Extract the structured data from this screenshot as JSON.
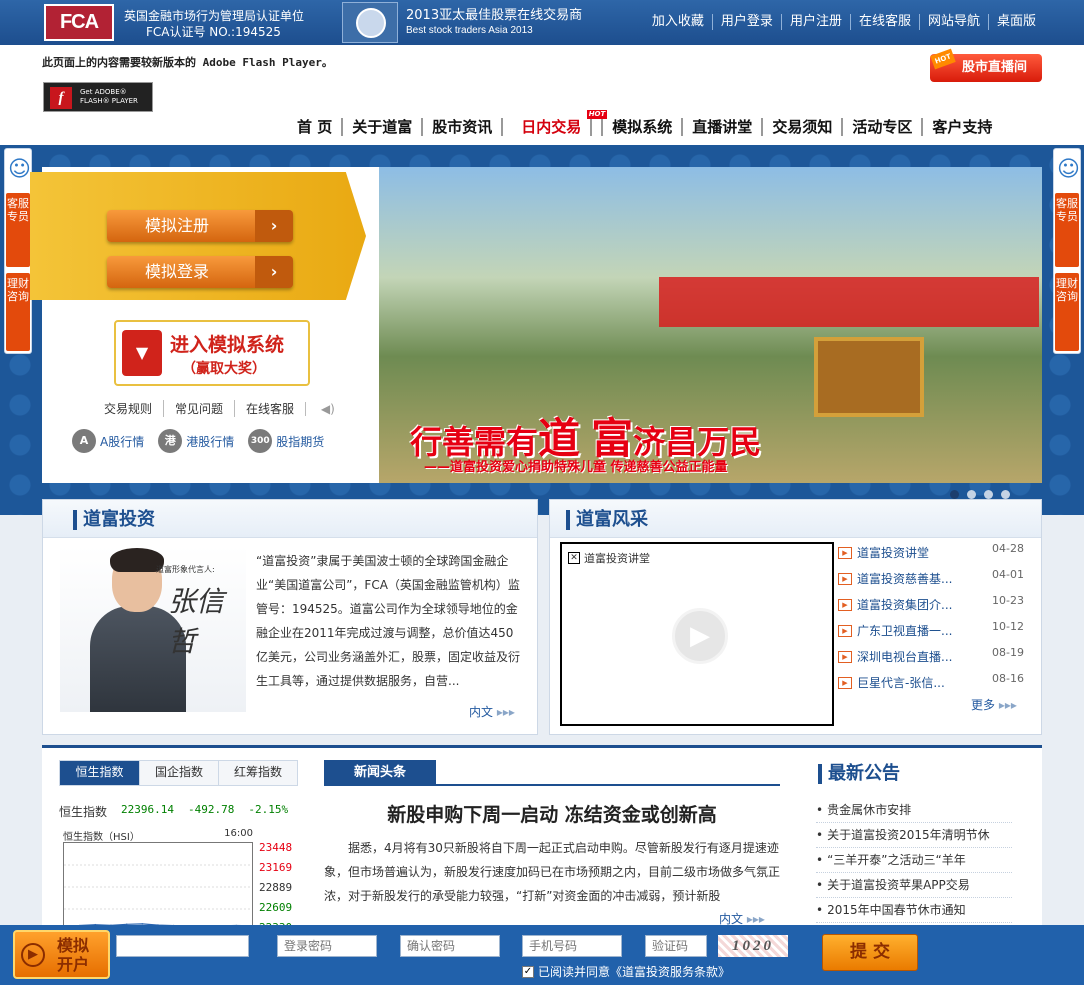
{
  "topbar": {
    "fca_logo": "FCA",
    "fca_line1": "英国金融市场行为管理局认证单位",
    "fca_line2": "FCA认证号    NO.:194525",
    "award_line1": "2013亚太最佳股票在线交易商",
    "award_line2": "Best stock traders Asia 2013",
    "links": [
      "加入收藏",
      "用户登录",
      "用户注册",
      "在线客服",
      "网站导航",
      "桌面版"
    ]
  },
  "header": {
    "flash_notice": "此页面上的内容需要较新版本的 Adobe Flash Player。",
    "flash_button_line1": "Get ADOBE®",
    "flash_button_line2": "FLASH® PLAYER",
    "live_button": "股市直播间",
    "live_badge": "HOT"
  },
  "main_nav": {
    "items": [
      "首 页",
      "关于道富",
      "股市资讯",
      "日内交易",
      "模拟系统",
      "直播讲堂",
      "交易须知",
      "活动专区",
      "客户支持"
    ],
    "hot_badge": "HOT"
  },
  "side_float": {
    "tab1": "客服专员",
    "tab2": "理财咨询"
  },
  "left_panel": {
    "register_btn": "模拟注册",
    "login_btn": "模拟登录",
    "enter_line1": "进入模拟系统",
    "enter_line2": "（赢取大奖）",
    "links": [
      "交易规则",
      "常见问题",
      "在线客服"
    ],
    "markets": [
      {
        "icon": "A",
        "label": "A股行情"
      },
      {
        "icon": "港",
        "label": "港股行情"
      },
      {
        "icon": "300",
        "label": "股指期货"
      }
    ]
  },
  "banner": {
    "title_a": "行善需有",
    "title_b": "道",
    "title_c": "富",
    "title_d": "济昌万民",
    "subtitle": "——道富投资爱心捐助特殊儿童 传递慈善公益正能量"
  },
  "invest_box": {
    "title": "道富投资",
    "caption": "道富形象代言人:",
    "signature": "张信哲",
    "text": "“道富投资”隶属于美国波士顿的全球跨国金融企业“美国道富公司”，FCA（英国金融监管机构）监管号：194525。道富公司作为全球领导地位的金融企业在2011年完成过渡与调整，总价值达450亿美元，公司业务涵盖外汇，股票，固定收益及衍生工具等，通过提供数据服务，自营...",
    "more": "内文"
  },
  "style_box": {
    "title": "道富风采",
    "video_label": "道富投资讲堂",
    "items": [
      {
        "title": "道富投资讲堂",
        "date": "04-28"
      },
      {
        "title": "道富投资慈善基...",
        "date": "04-01"
      },
      {
        "title": "道富投资集团介...",
        "date": "10-23"
      },
      {
        "title": "广东卫视直播一...",
        "date": "10-12"
      },
      {
        "title": "深圳电视台直播...",
        "date": "08-19"
      },
      {
        "title": "巨星代言-张信...",
        "date": "08-16"
      }
    ],
    "more": "更多"
  },
  "index_panel": {
    "tabs": [
      "恒生指数",
      "国企指数",
      "红筹指数"
    ],
    "name": "恒生指数",
    "value": "22396.14",
    "change": "-492.78",
    "pct": "-2.15%",
    "chart_caption": "恒生指数（HSI）",
    "chart_time": "16:00",
    "levels": [
      "23448",
      "23169",
      "22889",
      "22609",
      "22330"
    ]
  },
  "chart_data": {
    "type": "line",
    "title": "恒生指数（HSI）",
    "ylim": [
      22330,
      23448
    ],
    "series": [
      {
        "values": [
          22395,
          22400,
          22410,
          22402,
          22415,
          22420,
          22405,
          22398,
          22392,
          22388,
          22395,
          22400,
          22396
        ]
      }
    ]
  },
  "news": {
    "tab": "新闻头条",
    "headline": "新股申购下周一启动 冻结资金或创新高",
    "body": "据悉，4月将有30只新股将自下周一起正式启动申购。尽管新股发行有逐月提速迹象，但市场普遍认为，新股发行速度加码已在市场预期之内，目前二级市场做多气氛正浓，对于新股发行的承受能力较强，“打新”对资金面的冲击减弱，预计新股",
    "more": "内文"
  },
  "notices": {
    "title": "最新公告",
    "items": [
      "贵金属休市安排",
      "关于道富投资2015年清明节休",
      "“三羊开泰”之活动三“羊年",
      "关于道富投资苹果APP交易",
      "2015年中国春节休市通知"
    ]
  },
  "signup_bar": {
    "open_line1": "模拟",
    "open_line2": "开户",
    "username_value": "",
    "password_placeholder": "登录密码",
    "confirm_placeholder": "确认密码",
    "phone_placeholder": "手机号码",
    "code_placeholder": "验证码",
    "captcha": "1020",
    "agree_text": "已阅读并同意《道富投资服务条款》",
    "submit": "提 交"
  }
}
